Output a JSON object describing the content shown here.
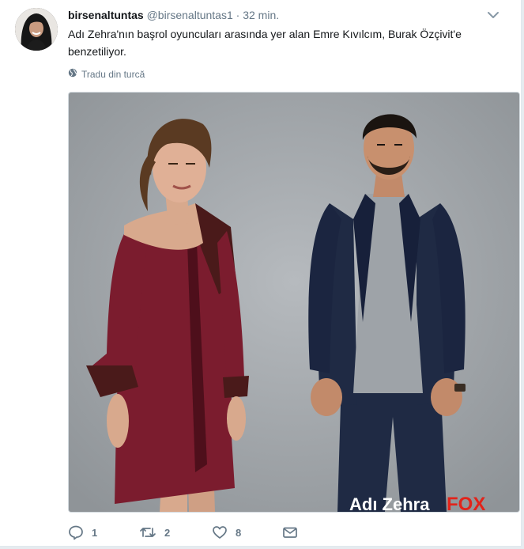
{
  "tweet": {
    "display_name": "birsenaltuntas",
    "handle": "@birsenaltuntas1",
    "separator": "·",
    "time": "32 min.",
    "text": "Adı Zehra'nın başrol oyuncuları arasında yer alan Emre Kıvılcım, Burak Özçivit'e benzetiliyor.",
    "translate_label": "Tradu din turcă"
  },
  "media": {
    "watermark_text": "Adı Zehra",
    "watermark_brand": "FOX"
  },
  "actions": {
    "reply_count": "1",
    "retweet_count": "2",
    "like_count": "8"
  },
  "colors": {
    "background": "#e6ecf0",
    "secondary_text": "#657786",
    "dress": "#7b1c2e",
    "jacket": "#1f2a44"
  }
}
